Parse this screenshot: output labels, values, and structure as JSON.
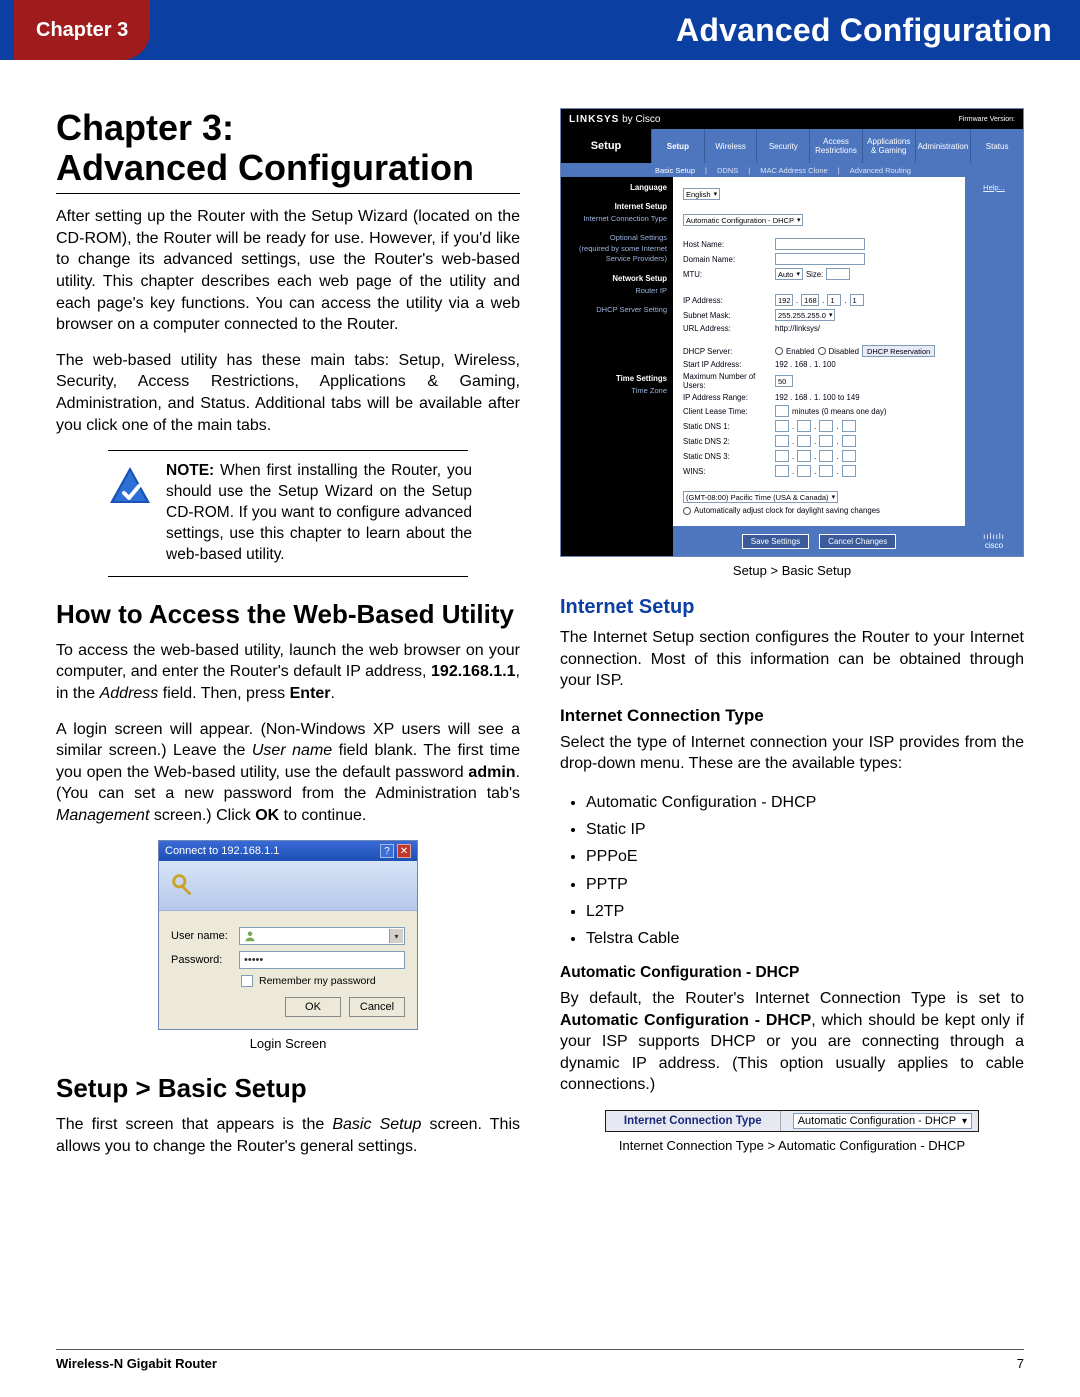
{
  "header": {
    "chapter_label": "Chapter 3",
    "title": "Advanced Configuration"
  },
  "footer": {
    "product": "Wireless-N Gigabit Router",
    "page": "7"
  },
  "left": {
    "h1_line1": "Chapter 3:",
    "h1_line2": "Advanced Configuration",
    "p1": "After setting up the Router with the Setup Wizard (located on the CD-ROM), the Router will be ready for use. However, if you'd like to change its advanced settings, use the Router's web-based utility. This chapter describes each web page of the utility and each page's key functions. You can access the utility via a web browser on a computer connected to the Router.",
    "p2": "The web-based utility has these main tabs: Setup, Wireless, Security, Access Restrictions, Applications & Gaming, Administration, and Status. Additional tabs will be available after you click one of the main tabs.",
    "note_label": "NOTE:",
    "note_text": " When first installing the Router, you should use the Setup Wizard on the Setup CD-ROM. If you want to configure advanced settings, use this chapter to learn about the web-based utility.",
    "h2_access": "How to Access the Web-Based Utility",
    "p3a": "To access the web-based utility, launch the web browser on your computer, and enter the Router's default IP address, ",
    "ip_bold": "192.168.1.1",
    "p3b": ", in the ",
    "address_italic": "Address",
    "p3c": " field. Then, press ",
    "enter_bold": "Enter",
    "p3d": ".",
    "p4a": "A login screen will appear. (Non-Windows XP users will see a similar screen.) Leave the ",
    "username_italic": "User name",
    "p4b": " field blank. The first time you open the Web-based utility, use the default password ",
    "admin_bold": "admin",
    "p4c": ". (You can set a new password from the Administration tab's ",
    "mgmt_italic": "Management",
    "p4d": " screen.) Click ",
    "ok_bold": "OK",
    "p4e": " to continue.",
    "login": {
      "title": "Connect to 192.168.1.1",
      "user_label": "User name:",
      "pass_label": "Password:",
      "pass_value": "•••••",
      "remember": "Remember my password",
      "ok": "OK",
      "cancel": "Cancel"
    },
    "caption_login": "Login Screen",
    "h2_basic": "Setup > Basic Setup",
    "p5a": "The first screen that appears is the ",
    "basic_italic": "Basic Setup",
    "p5b": " screen. This allows you to change the Router's general settings."
  },
  "right": {
    "linksys": {
      "brand": "LINKSYS",
      "by": "by Cisco",
      "fw_label": "Firmware Version:",
      "section_label": "Setup",
      "tabs": [
        "Setup",
        "Wireless",
        "Security",
        "Access Restrictions",
        "Applications & Gaming",
        "Administration",
        "Status"
      ],
      "subnav": [
        "Basic Setup",
        "DDNS",
        "MAC Address Clone",
        "Advanced Routing"
      ],
      "sidebar": {
        "language_h": "Language",
        "internet_h": "Internet Setup",
        "internet_i1": "Internet Connection Type",
        "optional_i1": "Optional Settings",
        "optional_i2": "(required by some Internet",
        "optional_i3": "Service Providers)",
        "network_h": "Network Setup",
        "network_i1": "Router IP",
        "dhcp_i1": "DHCP Server Setting",
        "time_h": "Time Settings",
        "time_i1": "Time Zone"
      },
      "content": {
        "language_sel": "English",
        "ict_sel": "Automatic Configuration - DHCP",
        "hostname_k": "Host Name:",
        "domainname_k": "Domain Name:",
        "mtu_k": "MTU:",
        "mtu_mode": "Auto",
        "mtu_size_k": "Size:",
        "ip_k": "IP Address:",
        "ip_v": [
          "192",
          "168",
          "1",
          "1"
        ],
        "subnet_k": "Subnet Mask:",
        "subnet_v": "255.255.255.0",
        "url_k": "URL Address:",
        "url_v": "http://linksys/",
        "dhcp_k": "DHCP Server:",
        "dhcp_en": "Enabled",
        "dhcp_dis": "Disabled",
        "dhcp_res": "DHCP Reservation",
        "start_k": "Start IP Address:",
        "start_v": "192 . 168 . 1. 100",
        "max_k": "Maximum Number of Users:",
        "max_v": "50",
        "range_k": "IP Address Range:",
        "range_v": "192 . 168 . 1. 100 to 149",
        "lease_k": "Client Lease Time:",
        "lease_v": "minutes (0 means one day)",
        "dns1_k": "Static DNS 1:",
        "dns2_k": "Static DNS 2:",
        "dns3_k": "Static DNS 3:",
        "wins_k": "WINS:",
        "tz_sel": "(GMT-08:00) Pacific Time (USA & Canada)",
        "tz_auto": "Automatically adjust clock for daylight saving changes"
      },
      "help": "Help...",
      "save": "Save Settings",
      "cancel": "Cancel Changes",
      "cisco": "cisco"
    },
    "caption_linksys": "Setup > Basic Setup",
    "h3_internet": "Internet Setup",
    "p_internet": "The Internet Setup section configures the Router to your Internet connection. Most of this information can be obtained through your ISP.",
    "h4_ict": "Internet Connection Type",
    "p_ict": "Select the type of Internet connection your ISP provides from the drop-down menu. These are the available types:",
    "bullets": [
      "Automatic Configuration - DHCP",
      "Static IP",
      "PPPoE",
      "PPTP",
      "L2TP",
      "Telstra Cable"
    ],
    "h5_autodhcp": "Automatic Configuration - DHCP",
    "p_autoa": "By default, the Router's Internet Connection Type is set to ",
    "p_autob_bold": "Automatic Configuration - DHCP",
    "p_autoc": ", which should be kept only if your ISP supports DHCP or you are connecting through a dynamic IP address. (This option usually applies to cable connections.)",
    "ictbar_label": "Internet Connection Type",
    "ictbar_value": "Automatic Configuration - DHCP",
    "caption_ictbar": "Internet Connection Type > Automatic Configuration - DHCP"
  }
}
